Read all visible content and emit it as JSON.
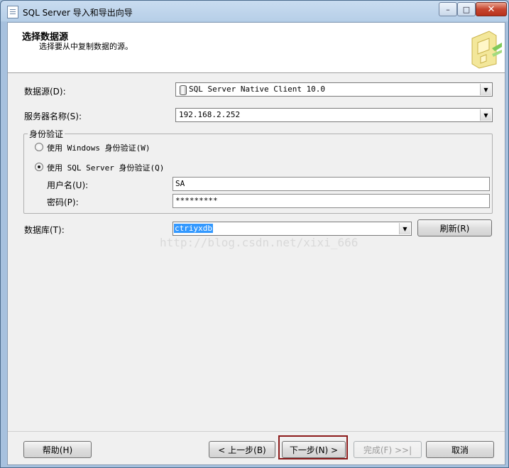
{
  "window": {
    "title": "SQL Server 导入和导出向导",
    "minimize": "–",
    "maximize": "□",
    "close": "✕"
  },
  "header": {
    "title": "选择数据源",
    "subtitle": "选择要从中复制数据的源。"
  },
  "form": {
    "data_source_label": "数据源(D):",
    "data_source_value": "SQL Server Native Client 10.0",
    "server_label": "服务器名称(S):",
    "server_value": "192.168.2.252",
    "auth_group_label": "身份验证",
    "auth_windows_label": "使用 Windows 身份验证(W)",
    "auth_sql_label": "使用 SQL Server 身份验证(Q)",
    "auth_selected": "sql",
    "username_label": "用户名(U):",
    "username_value": "SA",
    "password_label": "密码(P):",
    "password_value": "*********",
    "database_label": "数据库(T):",
    "database_value": "ctriyxdb",
    "refresh_button": "刷新(R)"
  },
  "watermark": "http://blog.csdn.net/xixi_666",
  "footer": {
    "help_button": "帮助(H)",
    "back_button": "< 上一步(B)",
    "next_button": "下一步(N) >",
    "finish_button": "完成(F) >>|",
    "cancel_button": "取消"
  },
  "icons": {
    "app": "wizard-app-icon",
    "header": "database-transfer-icon",
    "datasource": "database-cylinder-icon"
  },
  "colors": {
    "highlight_border": "#8b1a1a",
    "selection": "#3399ff"
  }
}
